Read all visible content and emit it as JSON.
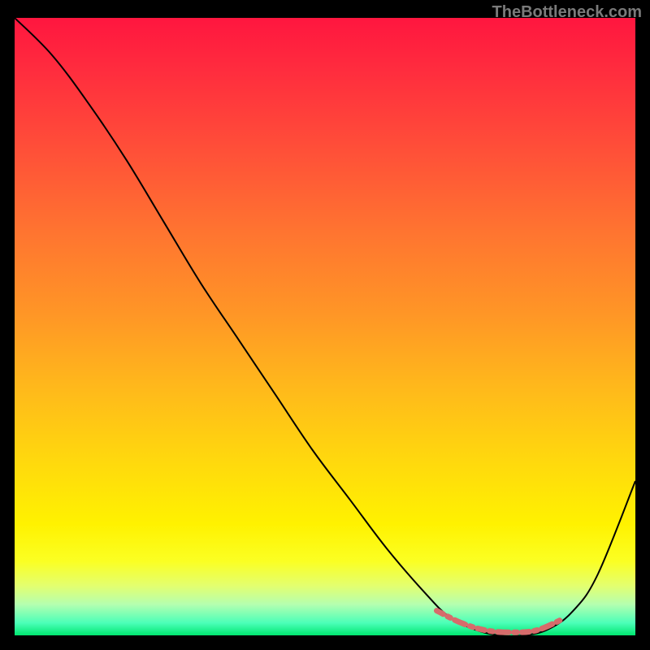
{
  "watermark": "TheBottleneck.com",
  "chart_data": {
    "type": "line",
    "title": "",
    "xlabel": "",
    "ylabel": "",
    "xlim": [
      0,
      100
    ],
    "ylim": [
      0,
      100
    ],
    "series": [
      {
        "name": "bottleneck-curve",
        "x": [
          0,
          6,
          12,
          18,
          24,
          30,
          36,
          42,
          48,
          54,
          60,
          66,
          70,
          74,
          78,
          82,
          86,
          90,
          94,
          100
        ],
        "y": [
          100,
          94,
          86,
          77,
          67,
          57,
          48,
          39,
          30,
          22,
          14,
          7,
          3,
          1,
          0,
          0,
          1,
          4,
          10,
          25
        ]
      }
    ],
    "highlight": {
      "name": "optimal-range",
      "x": [
        68,
        72,
        76,
        80,
        84,
        88
      ],
      "y": [
        4,
        2,
        0.8,
        0.5,
        0.8,
        2.5
      ]
    },
    "background_gradient": {
      "top": "#ff163f",
      "mid": "#ffd90d",
      "bottom": "#00e770"
    }
  }
}
